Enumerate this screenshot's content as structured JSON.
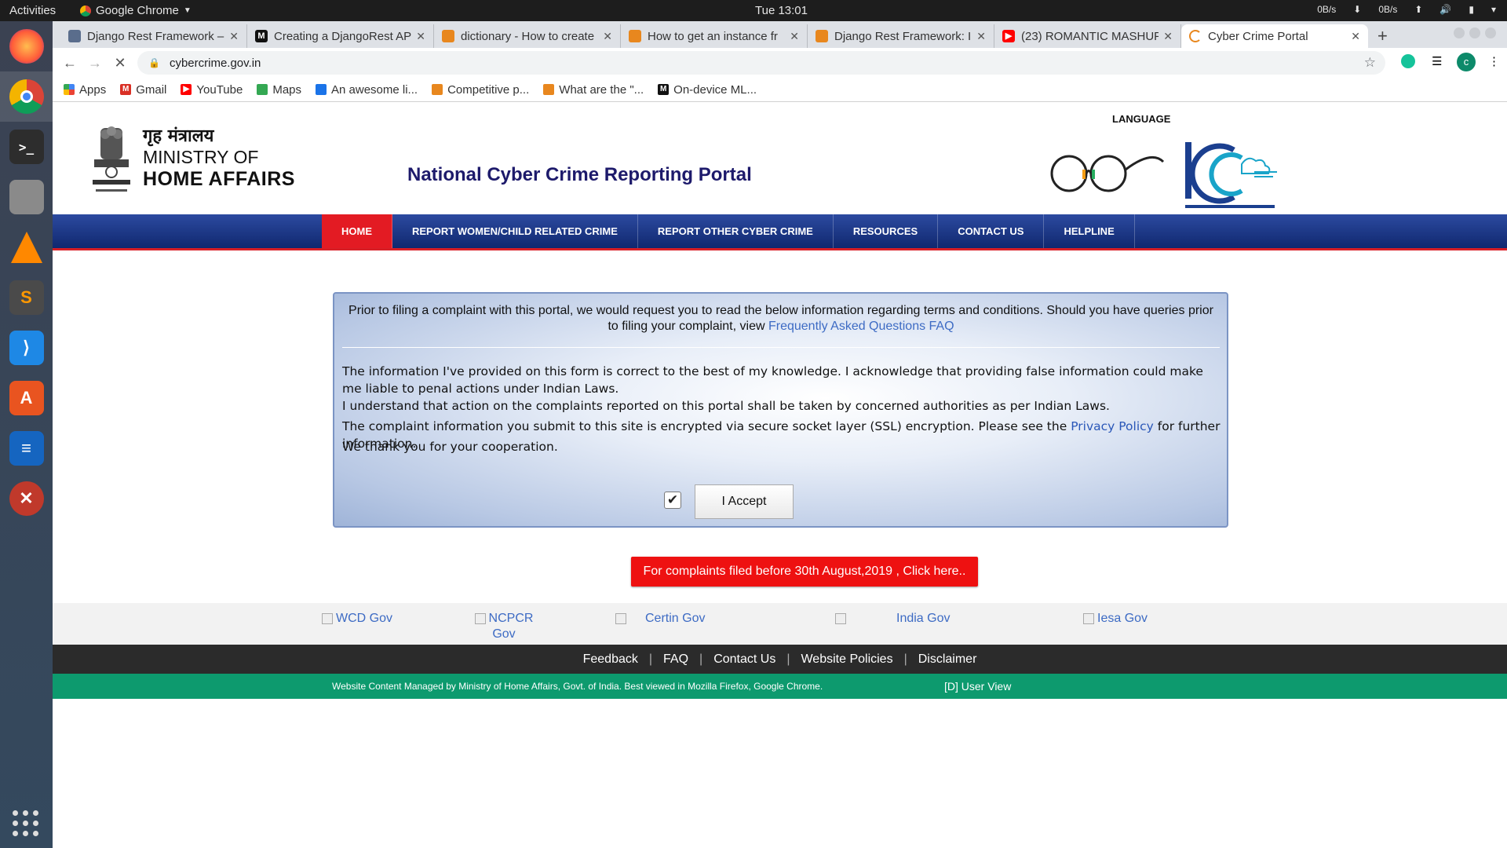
{
  "os": {
    "activities": "Activities",
    "app_name": "Google Chrome",
    "clock": "Tue 13:01",
    "net_down": "0B/s",
    "net_up": "0B/s"
  },
  "browser": {
    "tabs": [
      {
        "label": "Django Rest Framework –",
        "favicon_color": "#5a6d8c"
      },
      {
        "label": "Creating a DjangoRest AP",
        "favicon_color": "#111111"
      },
      {
        "label": "dictionary - How to create",
        "favicon_color": "#e8871e"
      },
      {
        "label": "How to get an instance fr",
        "favicon_color": "#e8871e"
      },
      {
        "label": "Django Rest Framework: I",
        "favicon_color": "#e8871e"
      },
      {
        "label": "(23) ROMANTIC MASHUP",
        "favicon_color": "#ff0000"
      },
      {
        "label": "Cyber Crime Portal",
        "favicon_color": "#e8871e"
      }
    ],
    "url": "cybercrime.gov.in",
    "profile_initial": "c",
    "bookmarks": [
      {
        "label": "Apps",
        "icon": "apps-grid-icon",
        "color": "#4285f4"
      },
      {
        "label": "Gmail",
        "icon": "gmail-icon",
        "color": "#d93025"
      },
      {
        "label": "YouTube",
        "icon": "youtube-icon",
        "color": "#ff0000"
      },
      {
        "label": "Maps",
        "icon": "maps-icon",
        "color": "#34a853"
      },
      {
        "label": "An awesome li...",
        "icon": "chart-icon",
        "color": "#1a73e8"
      },
      {
        "label": "Competitive p...",
        "icon": "stack-icon",
        "color": "#e8871e"
      },
      {
        "label": "What are the \"...",
        "icon": "stack-icon",
        "color": "#e8871e"
      },
      {
        "label": "On-device ML...",
        "icon": "medium-icon",
        "color": "#111111"
      }
    ]
  },
  "header": {
    "hindi_ministry": "गृह मंत्रालय",
    "ministry_line1": "MINISTRY OF",
    "ministry_line2": "HOME AFFAIRS",
    "portal_title": "National Cyber Crime Reporting Portal",
    "language": "LANGUAGE"
  },
  "nav": {
    "items": [
      {
        "label": "HOME"
      },
      {
        "label": "REPORT WOMEN/CHILD RELATED CRIME"
      },
      {
        "label": "REPORT OTHER CYBER CRIME"
      },
      {
        "label": "RESOURCES"
      },
      {
        "label": "CONTACT US"
      },
      {
        "label": "HELPLINE"
      }
    ]
  },
  "terms": {
    "intro": "Prior to filing a complaint with this portal, we would request you to read the below information regarding terms and conditions. Should you have queries prior to filing your complaint, view",
    "faq_link": "Frequently Asked Questions FAQ",
    "p1": "The information I've provided on this form is correct to the best of my knowledge. I acknowledge that providing false information could make me liable to penal actions under Indian Laws.",
    "p2": "I understand that action on the complaints reported on this portal shall be taken by concerned authorities as per Indian Laws.",
    "p3_before": "The complaint information you submit to this site is encrypted via secure socket layer (SSL) encryption. Please see the",
    "p3_link": "Privacy Policy",
    "p3_after": "for further information.",
    "p4": "We thank you for your cooperation.",
    "accept_label": "I Accept",
    "checkbox_checked": true
  },
  "old_complaints_button": "For complaints filed before 30th August,2019 , Click here..",
  "partners": [
    {
      "label": "WCD Gov"
    },
    {
      "label": "NCPCR Gov"
    },
    {
      "label": "Certin Gov"
    },
    {
      "label": "India Gov"
    },
    {
      "label": "Iesa Gov"
    }
  ],
  "footer": {
    "links": [
      "Feedback",
      "FAQ",
      "Contact Us",
      "Website Policies",
      "Disclaimer"
    ],
    "managed": "Website Content Managed by Ministry of Home Affairs, Govt. of India. Best viewed in Mozilla Firefox, Google Chrome.",
    "user_view": "[D] User View"
  },
  "colors": {
    "nav_blue": "#10286f",
    "nav_active": "#e31b23",
    "title_color": "#1d1a6b",
    "footer_green": "#0d9a6e"
  }
}
